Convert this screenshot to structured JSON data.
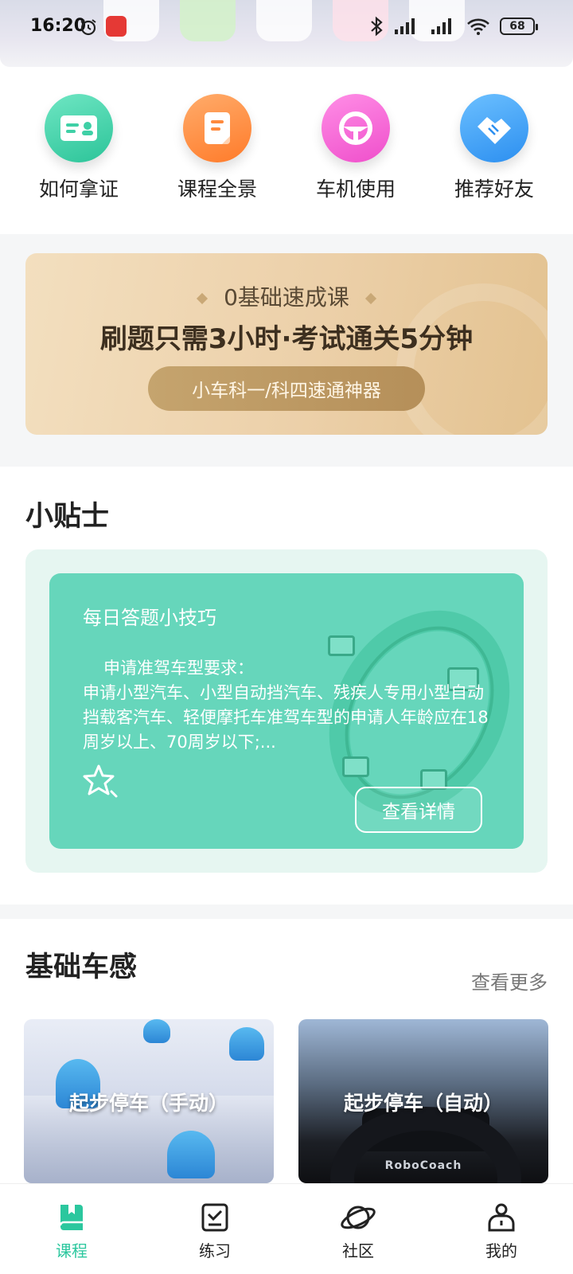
{
  "status_bar": {
    "time": "16:20",
    "battery": "68"
  },
  "quick_menu": [
    {
      "label": "如何拿证",
      "icon": "license-card-icon",
      "color": "#3fd0a6"
    },
    {
      "label": "课程全景",
      "icon": "clipboard-icon",
      "color": "#ff8a3d"
    },
    {
      "label": "车机使用",
      "icon": "steering-wheel-icon",
      "color": "#f35fd1"
    },
    {
      "label": "推荐好友",
      "icon": "handshake-icon",
      "color": "#3d9ff5"
    }
  ],
  "promo": {
    "kicker": "0基础速成课",
    "title": "刷题只需3小时·考试通关5分钟",
    "button": "小车科一/科四速通神器"
  },
  "tips": {
    "section_title": "小贴士",
    "card_title": "每日答题小技巧",
    "body_sub": "申请准驾车型要求：",
    "body": "申请小型汽车、小型自动挡汽车、残疾人专用小型自动挡载客汽车、轻便摩托车准驾车型的申请人年龄应在18周岁以上、70周岁以下;...",
    "button": "查看详情"
  },
  "car_sense": {
    "section_title": "基础车感",
    "more": "查看更多",
    "videos": [
      {
        "title": "起步停车（手动）"
      },
      {
        "title": "起步停车（自动）",
        "brand": "RoboCoach"
      }
    ]
  },
  "bottom_nav": [
    {
      "label": "课程",
      "icon": "book-icon",
      "active": true
    },
    {
      "label": "练习",
      "icon": "checklist-icon",
      "active": false
    },
    {
      "label": "社区",
      "icon": "planet-icon",
      "active": false
    },
    {
      "label": "我的",
      "icon": "profile-icon",
      "active": false
    }
  ],
  "accent_color": "#2bc79e"
}
